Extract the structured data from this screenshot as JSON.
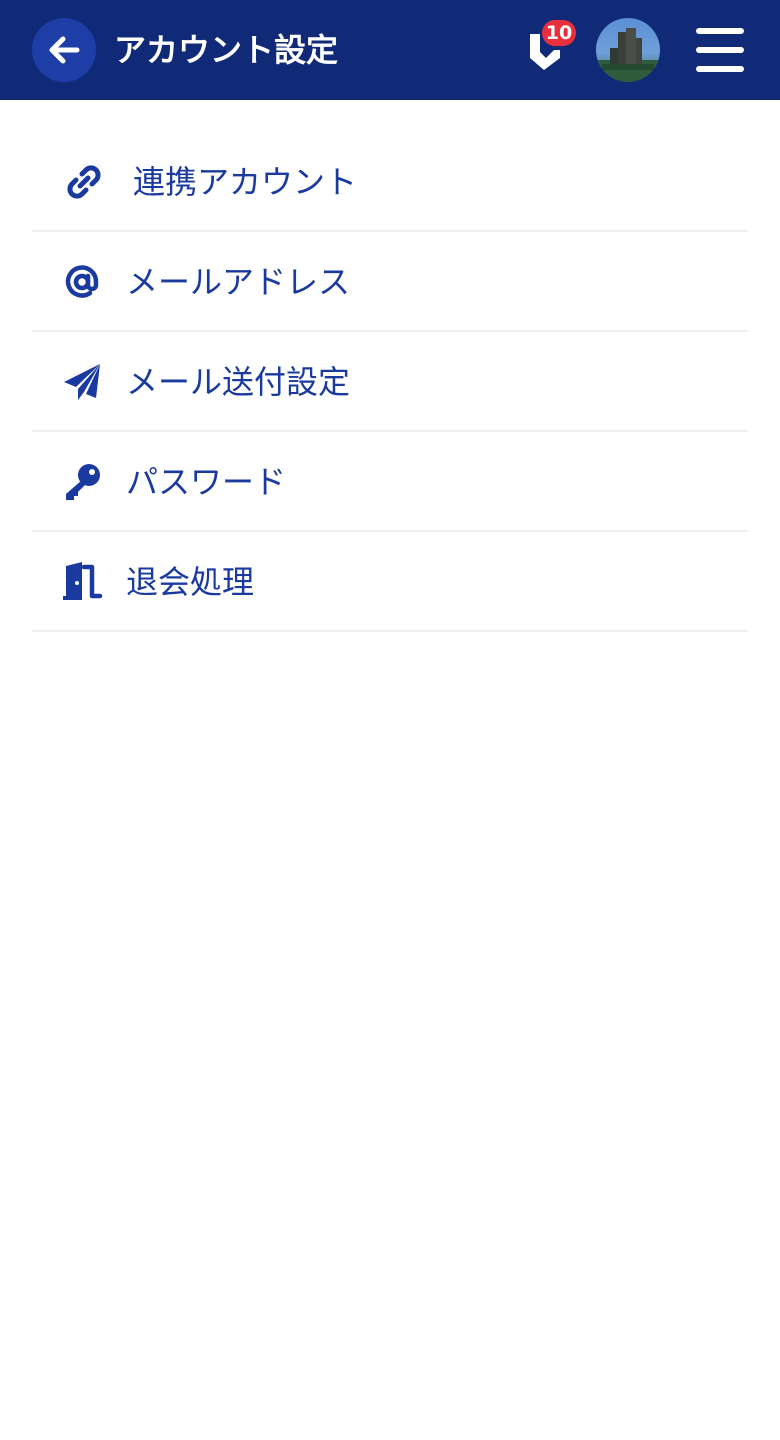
{
  "header": {
    "title": "アカウント設定",
    "back_icon": "arrow-left-icon",
    "notification_icon": "notification-icon",
    "notification_count": "10",
    "avatar_icon": "user-avatar",
    "menu_icon": "hamburger-menu-icon"
  },
  "menu": {
    "items": [
      {
        "label": "連携アカウント",
        "icon": "link-icon"
      },
      {
        "label": "メールアドレス",
        "icon": "at-sign-icon"
      },
      {
        "label": "メール送付設定",
        "icon": "paper-plane-icon"
      },
      {
        "label": "パスワード",
        "icon": "key-icon"
      },
      {
        "label": "退会処理",
        "icon": "door-exit-icon"
      }
    ]
  },
  "colors": {
    "header_bg": "#112a78",
    "back_button_bg": "#1d3ea6",
    "accent_text": "#1b3aa0",
    "badge": "#e8303c",
    "divider": "#eeeeee"
  }
}
